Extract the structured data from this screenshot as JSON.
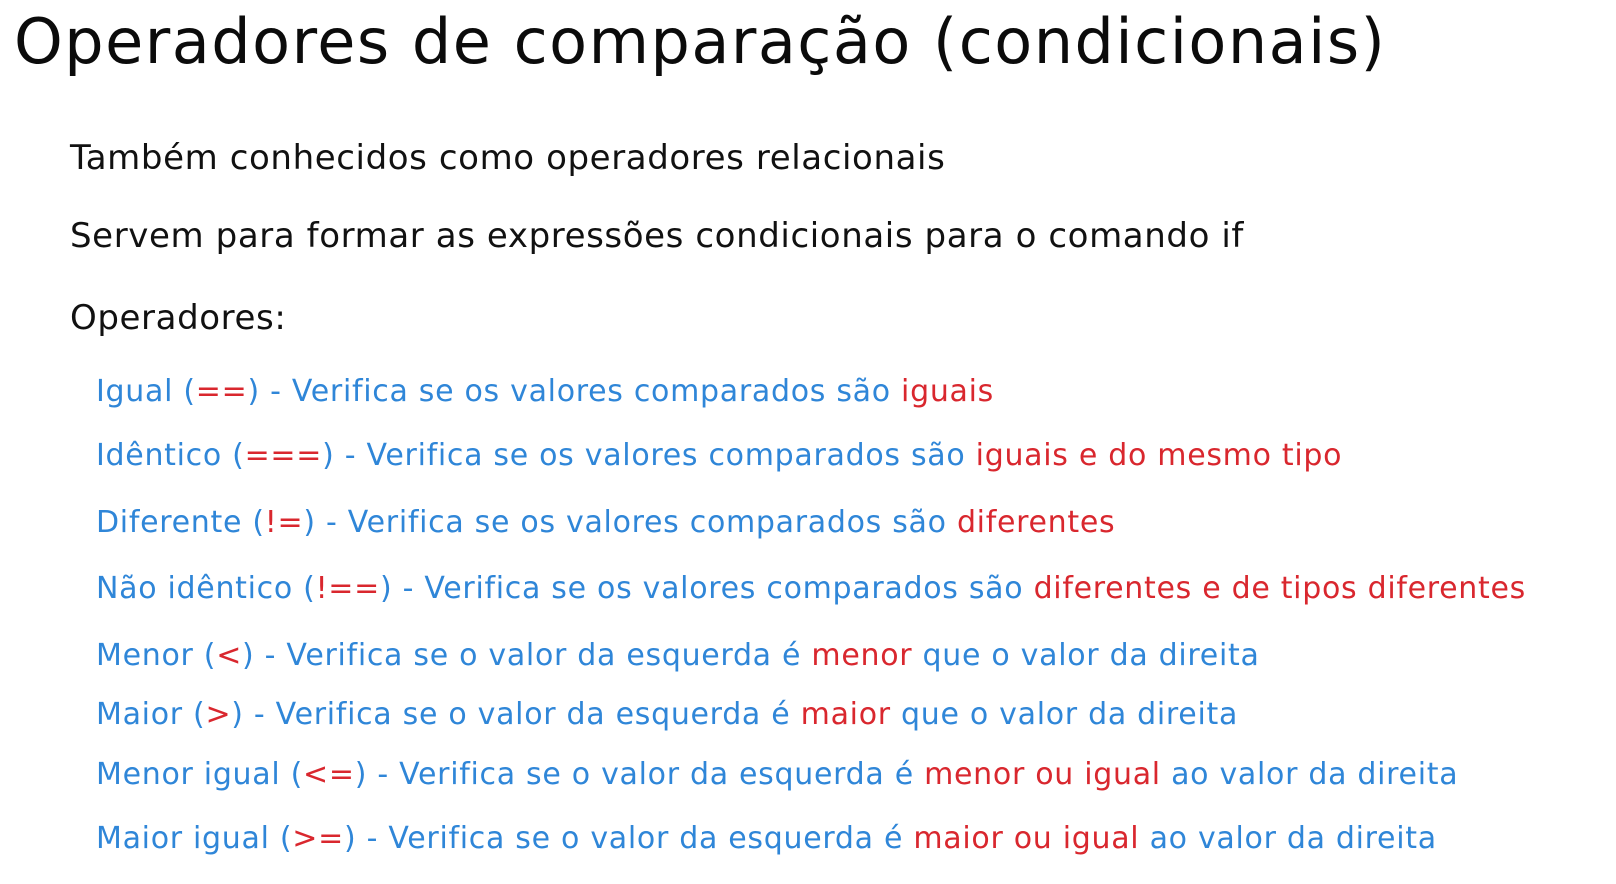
{
  "colors": {
    "title": "#0b0b0b",
    "text": "#111111",
    "operator_text": "#2f86d8",
    "highlight": "#d9272e"
  },
  "title": "Operadores de comparação (condicionais)",
  "intro": [
    "Também conhecidos como operadores relacionais",
    "Servem para formar as expressões condicionais para o comando if",
    "Operadores:"
  ],
  "operators": [
    {
      "name": "Igual (",
      "symbol": "==",
      "mid": ") - Verifica se os valores comparados são ",
      "highlight": "iguais",
      "tail": ""
    },
    {
      "name": "Idêntico (",
      "symbol": "===",
      "mid": ") - Verifica se os valores comparados são ",
      "highlight": "iguais e do mesmo tipo",
      "tail": ""
    },
    {
      "name": "Diferente (",
      "symbol": "!=",
      "mid": ") - Verifica se os valores comparados são ",
      "highlight": "diferentes",
      "tail": ""
    },
    {
      "name": "Não idêntico (",
      "symbol": "!==",
      "mid": ") - Verifica se os valores comparados são ",
      "highlight": "diferentes e de tipos diferentes",
      "tail": ""
    },
    {
      "name": "Menor (",
      "symbol": "<",
      "mid": ") - Verifica se o valor da esquerda é ",
      "highlight": "menor",
      "tail": " que o valor da direita"
    },
    {
      "name": "Maior (",
      "symbol": ">",
      "mid": ") - Verifica se o valor da esquerda é ",
      "highlight": "maior",
      "tail": " que o valor da direita"
    },
    {
      "name": "Menor igual (",
      "symbol": "<=",
      "mid": ") - Verifica se o valor da esquerda é ",
      "highlight": "menor ou igual",
      "tail": " ao valor da direita"
    },
    {
      "name": "Maior igual (",
      "symbol": ">=",
      "mid": ") - Verifica se o valor da esquerda é ",
      "highlight": "maior ou igual",
      "tail": " ao valor da direita"
    }
  ]
}
